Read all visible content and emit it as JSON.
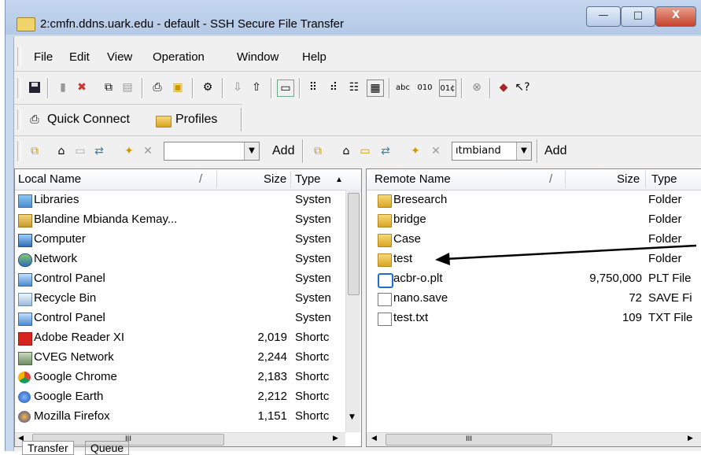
{
  "window": {
    "title": "2:cmfn.ddns.uark.edu - default - SSH Secure File Transfer",
    "minimize_glyph": "—",
    "maximize_glyph": "□",
    "close_glyph": "X"
  },
  "menu": [
    "File",
    "Edit",
    "View",
    "Operation",
    "Window",
    "Help"
  ],
  "quickbar": {
    "quick_connect": "Quick Connect",
    "profiles": "Profiles"
  },
  "local": {
    "add_label": "Add",
    "path_value": "",
    "columns": {
      "name": "Local Name",
      "sort": "/",
      "size": "Size",
      "type": "Type"
    },
    "rows": [
      {
        "name": "Libraries",
        "size": "",
        "type": "Systen",
        "icon": "libraries-icon"
      },
      {
        "name": "Blandine Mbianda Kemay...",
        "size": "",
        "type": "Systen",
        "icon": "user-folder-icon"
      },
      {
        "name": "Computer",
        "size": "",
        "type": "Systen",
        "icon": "computer-icon"
      },
      {
        "name": "Network",
        "size": "",
        "type": "Systen",
        "icon": "network-icon"
      },
      {
        "name": "Control Panel",
        "size": "",
        "type": "Systen",
        "icon": "control-panel-icon"
      },
      {
        "name": "Recycle Bin",
        "size": "",
        "type": "Systen",
        "icon": "recycle-bin-icon"
      },
      {
        "name": "Control Panel",
        "size": "",
        "type": "Systen",
        "icon": "control-panel-icon"
      },
      {
        "name": "Adobe Reader XI",
        "size": "2,019",
        "type": "Shortc",
        "icon": "adobe-reader-icon"
      },
      {
        "name": "CVEG Network",
        "size": "2,244",
        "type": "Shortc",
        "icon": "network-shortcut-icon"
      },
      {
        "name": "Google Chrome",
        "size": "2,183",
        "type": "Shortc",
        "icon": "chrome-icon"
      },
      {
        "name": "Google Earth",
        "size": "2,212",
        "type": "Shortc",
        "icon": "google-earth-icon"
      },
      {
        "name": "Mozilla Firefox",
        "size": "1,151",
        "type": "Shortc",
        "icon": "firefox-icon"
      }
    ]
  },
  "remote": {
    "add_label": "Add",
    "path_value": "ıtmbiand",
    "columns": {
      "name": "Remote Name",
      "sort": "/",
      "size": "Size",
      "type": "Type"
    },
    "rows": [
      {
        "name": "Bresearch",
        "size": "",
        "type": "Folder",
        "icon": "folder-icon"
      },
      {
        "name": "bridge",
        "size": "",
        "type": "Folder",
        "icon": "folder-icon"
      },
      {
        "name": "Case",
        "size": "",
        "type": "Folder",
        "icon": "folder-icon"
      },
      {
        "name": "test",
        "size": "",
        "type": "Folder",
        "icon": "folder-icon"
      },
      {
        "name": "acbr-o.plt",
        "size": "9,750,000",
        "type": "PLT File",
        "icon": "plt-file-icon"
      },
      {
        "name": "nano.save",
        "size": "72",
        "type": "SAVE Fi",
        "icon": "file-icon"
      },
      {
        "name": "test.txt",
        "size": "109",
        "type": "TXT File",
        "icon": "file-icon"
      }
    ]
  },
  "scrollbar": {
    "thumb_glyph": "III"
  },
  "bottom_tabs": [
    "Transfer",
    "Queue"
  ],
  "colors": {
    "titlebar": "#b9cde8",
    "accent": "#0b57a4",
    "folder": "#e8bf45",
    "arrow": "#000000"
  }
}
